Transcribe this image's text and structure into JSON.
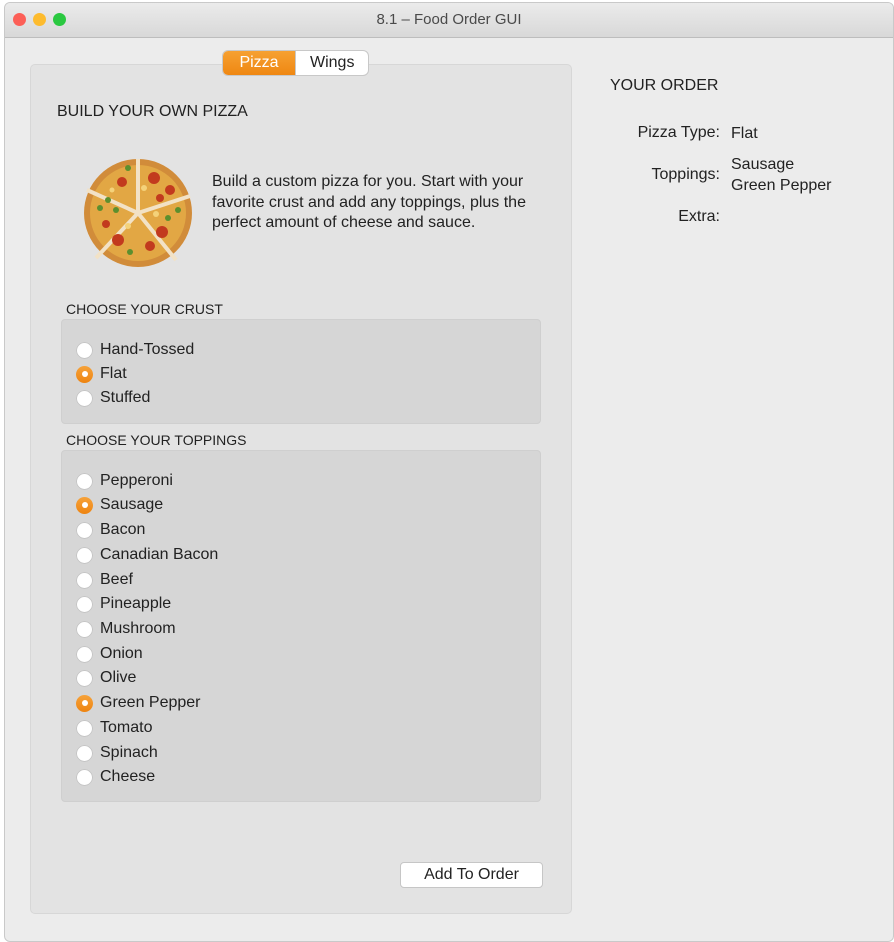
{
  "window": {
    "title": "8.1 – Food Order GUI",
    "traffic_lights": [
      "close",
      "minimize",
      "zoom"
    ],
    "colors": {
      "close": "#fc5f57",
      "minimize": "#fdbb2e",
      "zoom": "#2ac840",
      "accent": "#f18a16"
    }
  },
  "tabs": {
    "pizza": "Pizza",
    "wings": "Wings",
    "selected": "Pizza"
  },
  "build": {
    "heading": "BUILD YOUR OWN PIZZA",
    "image": "pizza-image",
    "description": "Build a custom pizza for you. Start with your favorite crust and add any toppings, plus the perfect amount of cheese and sauce."
  },
  "crust": {
    "label": "CHOOSE YOUR CRUST",
    "options": [
      {
        "label": "Hand-Tossed",
        "selected": false
      },
      {
        "label": "Flat",
        "selected": true
      },
      {
        "label": "Stuffed",
        "selected": false
      }
    ]
  },
  "toppings": {
    "label": "CHOOSE YOUR TOPPINGS",
    "options": [
      {
        "label": "Pepperoni",
        "selected": false
      },
      {
        "label": "Sausage",
        "selected": true
      },
      {
        "label": "Bacon",
        "selected": false
      },
      {
        "label": "Canadian Bacon",
        "selected": false
      },
      {
        "label": "Beef",
        "selected": false
      },
      {
        "label": "Pineapple",
        "selected": false
      },
      {
        "label": "Mushroom",
        "selected": false
      },
      {
        "label": "Onion",
        "selected": false
      },
      {
        "label": "Olive",
        "selected": false
      },
      {
        "label": "Green Pepper",
        "selected": true
      },
      {
        "label": "Tomato",
        "selected": false
      },
      {
        "label": "Spinach",
        "selected": false
      },
      {
        "label": "Cheese",
        "selected": false
      }
    ]
  },
  "add_button": "Add To Order",
  "order": {
    "title": "YOUR ORDER",
    "pizza_type_label": "Pizza Type:",
    "pizza_type_value": "Flat",
    "toppings_label": "Toppings:",
    "toppings_values": [
      "Sausage",
      "Green Pepper"
    ],
    "extra_label": "Extra:",
    "extra_value": ""
  }
}
